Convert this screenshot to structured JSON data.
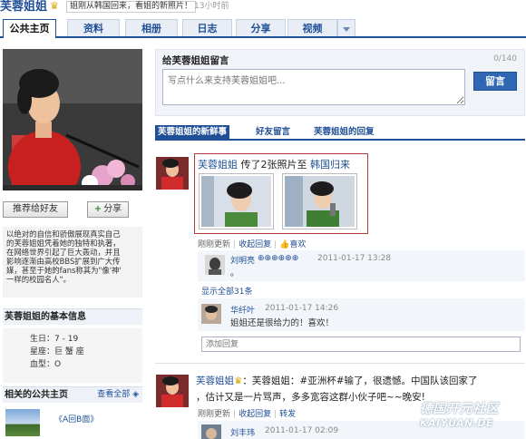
{
  "header": {
    "name": "芙蓉姐姐",
    "status": "姐刚从韩国回来，看姐的新照片！",
    "status_time": "13小时前"
  },
  "tabs": [
    {
      "label": "公共主页"
    },
    {
      "label": "资料"
    },
    {
      "label": "相册"
    },
    {
      "label": "日志"
    },
    {
      "label": "分享"
    },
    {
      "label": "视频"
    }
  ],
  "left": {
    "recommend_label": "推荐给好友",
    "share_label": "分享",
    "intro_lines": [
      "以绝对的自信和骄傲展现真实自己",
      "的芙蓉姐姐凭着她的独特和执著，",
      "在网络世界引起了巨大轰动，并且",
      "影响逐渐由高校BBS扩展到广大传",
      "媒，甚至于她的fans称其为\"像'神'",
      "一样的校园名人\"。"
    ],
    "basic_title": "芙蓉姐姐的基本信息",
    "basic": [
      {
        "key": "生日",
        "value": "7 - 19"
      },
      {
        "key": "星座",
        "value": "巨 蟹 座"
      },
      {
        "key": "血型",
        "value": "O"
      }
    ],
    "related_title": "相关的公共主页",
    "related_more": "查看全部",
    "related_item": "《A回B面》"
  },
  "message": {
    "title": "给芙蓉姐姐留言",
    "count": "0/140",
    "placeholder": "写点什么来支持芙蓉姐姐吧...",
    "submit": "留言"
  },
  "subtabs": [
    {
      "label": "芙蓉姐姐的新鲜事"
    },
    {
      "label": "好友留言"
    },
    {
      "label": "芙蓉姐姐的回复"
    }
  ],
  "feed1": {
    "name": "芙蓉姐姐",
    "text": "传了2张照片至",
    "album": "韩国归来",
    "meta_time": "刚刚更新",
    "reply": "收起回复",
    "like": "喜欢"
  },
  "replies": [
    {
      "name": "刘明亮",
      "extra": "⊕⊕⊕⊕⊕⊕",
      "time": "2011-01-17 13:28",
      "text": "。"
    },
    {
      "name": "华纤叶",
      "time": "2011-01-17 14:26",
      "text": "姐姐还是很给力的！喜欢！"
    }
  ],
  "show_all": "显示全部31条",
  "reply_placeholder": "添加回复",
  "feed2": {
    "name": "芙蓉姐姐",
    "text_1": "：芙蓉姐姐：#亚洲杯#输了，很遗憾。中国队该回家了",
    "text_2": "，估计又是一片骂声，多多宽容这群小伙子吧~~晚安!",
    "meta_time": "刚刚更新",
    "reply": "收起回复",
    "forward": "转发",
    "reply_name": "刘丰玮",
    "reply_time": "2011-01-17 02:09"
  },
  "watermark": {
    "line1": "德国开元社区",
    "line2": "KAIYUAN.DE"
  }
}
